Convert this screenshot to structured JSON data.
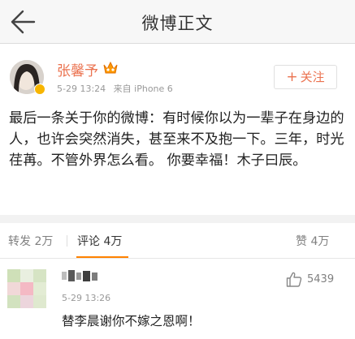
{
  "header": {
    "title": "微博正文",
    "back_icon": "arrow-left-icon"
  },
  "post": {
    "username": "张馨予",
    "timestamp": "5-29 13:24",
    "source": "来自 iPhone 6",
    "follow_label": "关注",
    "text": "最后一条关于你的微博：有时候你以为一辈子在身边的人，也许会突然消失，甚至来不及抱一下。三年，时光荏苒。不管外界怎么看。 你要幸福！木子曰辰。",
    "username_color": "#eb7350"
  },
  "stats": {
    "reposts": "转发 2万",
    "comments": "评论 4万",
    "likes": "赞 4万",
    "active_tab_color": "#ff8200"
  },
  "comment": {
    "timestamp": "5-29 13:26",
    "like_count": "5439",
    "text": "替李晨谢你不嫁之恩啊！"
  }
}
